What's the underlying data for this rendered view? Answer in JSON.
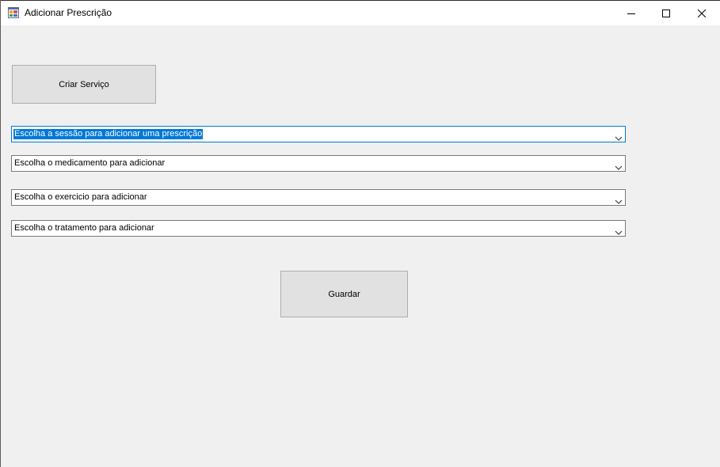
{
  "window": {
    "title": "Adicionar Prescrição",
    "icon": "windows-form-icon"
  },
  "title_controls": {
    "minimize_icon": "minimize-icon",
    "maximize_icon": "maximize-icon",
    "close_icon": "close-icon"
  },
  "buttons": {
    "criar_servico": "Criar Serviço",
    "guardar": "Guardar"
  },
  "combos": {
    "sessao": {
      "value": "Escolha a sessão para adicionar uma prescrição",
      "focused": true
    },
    "medicamento": {
      "value": "Escolha o medicamento para adicionar"
    },
    "exercicio": {
      "value": "Escolha o exercicio para adicionar"
    },
    "tratamento": {
      "value": "Escolha o tratamento para adicionar"
    }
  },
  "colors": {
    "background": "#f0f0f0",
    "button_face": "#e1e1e1",
    "selection": "#0078d7"
  }
}
